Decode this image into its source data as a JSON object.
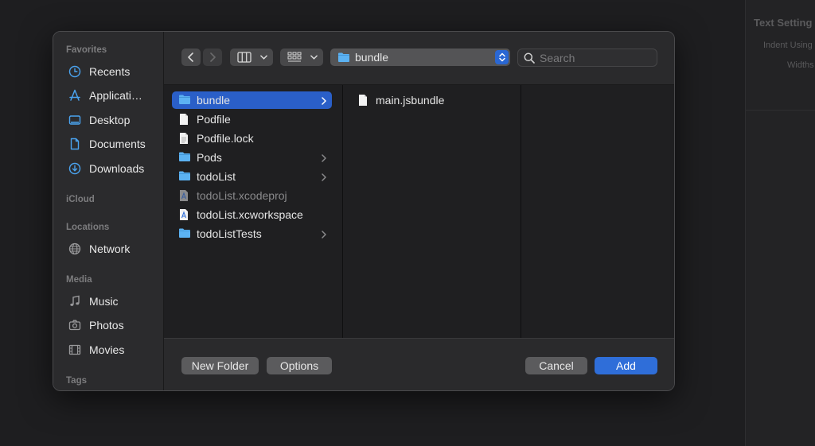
{
  "background_inspector": {
    "title": "Text Setting",
    "row1": "Indent Using",
    "row2": "Widths"
  },
  "sidebar": {
    "favorites_label": "Favorites",
    "favorites": [
      {
        "label": "Recents",
        "icon": "clock-icon"
      },
      {
        "label": "Applicati…",
        "icon": "applications-icon"
      },
      {
        "label": "Desktop",
        "icon": "desktop-icon"
      },
      {
        "label": "Documents",
        "icon": "document-icon"
      },
      {
        "label": "Downloads",
        "icon": "download-icon"
      }
    ],
    "icloud_label": "iCloud",
    "locations_label": "Locations",
    "locations": [
      {
        "label": "Network",
        "icon": "globe-icon"
      }
    ],
    "media_label": "Media",
    "media": [
      {
        "label": "Music",
        "icon": "music-note-icon"
      },
      {
        "label": "Photos",
        "icon": "camera-icon"
      },
      {
        "label": "Movies",
        "icon": "film-icon"
      }
    ],
    "tags_label": "Tags"
  },
  "toolbar": {
    "path": "bundle",
    "search_placeholder": "Search"
  },
  "column1": [
    {
      "name": "bundle",
      "kind": "folder",
      "selected": true,
      "has_children": true
    },
    {
      "name": "Podfile",
      "kind": "file"
    },
    {
      "name": "Podfile.lock",
      "kind": "textfile"
    },
    {
      "name": "Pods",
      "kind": "folder",
      "has_children": true
    },
    {
      "name": "todoList",
      "kind": "folder",
      "has_children": true
    },
    {
      "name": "todoList.xcodeproj",
      "kind": "xcodeproj",
      "dimmed": true
    },
    {
      "name": "todoList.xcworkspace",
      "kind": "xcworkspace"
    },
    {
      "name": "todoListTests",
      "kind": "folder",
      "has_children": true
    }
  ],
  "column2": [
    {
      "name": "main.jsbundle",
      "kind": "file"
    }
  ],
  "footer": {
    "new_folder": "New Folder",
    "options": "Options",
    "cancel": "Cancel",
    "add": "Add"
  },
  "colors": {
    "accent": "#2a5fc8",
    "folder": "#5cb2f2"
  }
}
